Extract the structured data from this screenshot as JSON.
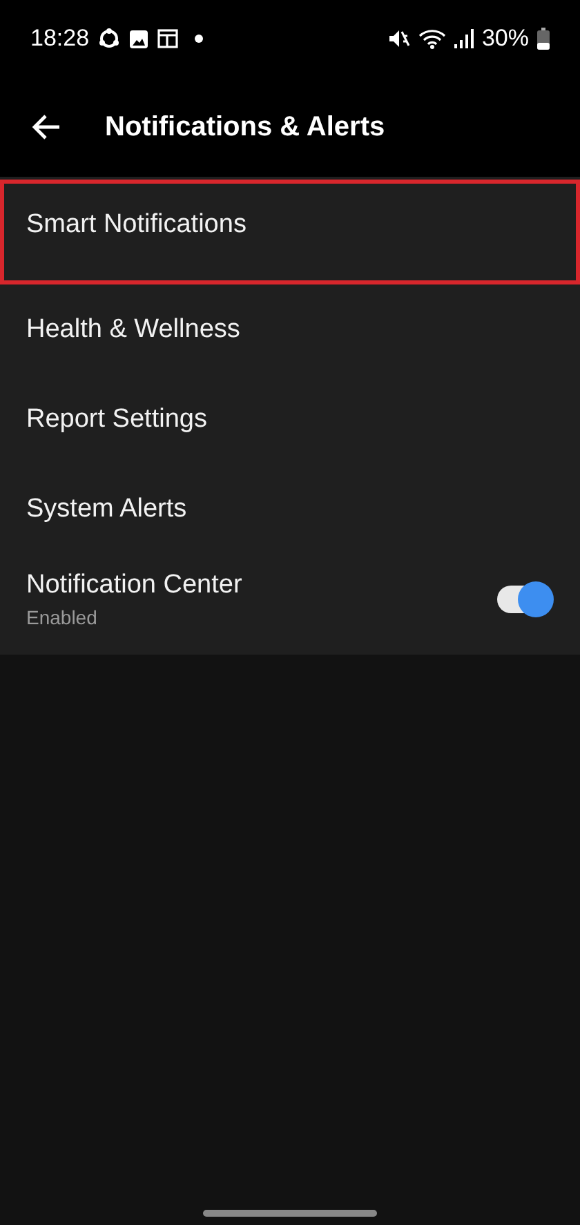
{
  "status_bar": {
    "time": "18:28",
    "battery": "30%"
  },
  "header": {
    "title": "Notifications & Alerts"
  },
  "items": [
    {
      "kind": "link",
      "label": "Smart Notifications",
      "highlighted": true
    },
    {
      "kind": "link",
      "label": "Health & Wellness",
      "highlighted": false
    },
    {
      "kind": "link",
      "label": "Report Settings",
      "highlighted": false
    },
    {
      "kind": "link",
      "label": "System Alerts",
      "highlighted": false
    },
    {
      "kind": "toggle",
      "label": "Notification Center",
      "subtitle": "Enabled",
      "on": true,
      "highlighted": false
    }
  ]
}
